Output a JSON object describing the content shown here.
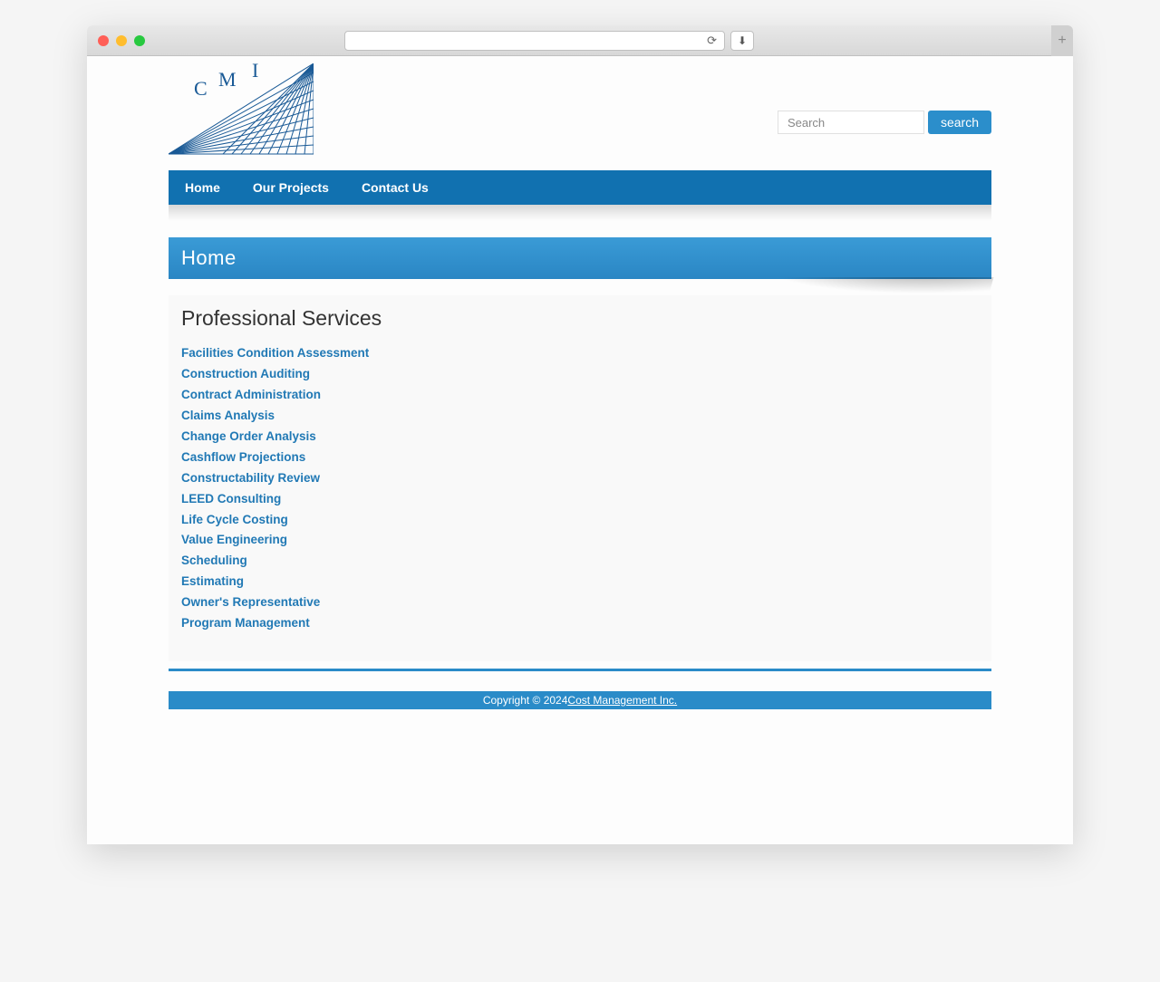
{
  "browser": {
    "url": ""
  },
  "logo": {
    "text_c": "C",
    "text_m": "M",
    "text_i": "I"
  },
  "search": {
    "placeholder": "Search",
    "button_label": "search"
  },
  "nav": {
    "items": [
      {
        "label": "Home"
      },
      {
        "label": "Our Projects"
      },
      {
        "label": "Contact Us"
      }
    ]
  },
  "page": {
    "title": "Home",
    "section_heading": "Professional Services"
  },
  "services": [
    "Facilities Condition Assessment",
    "Construction Auditing",
    "Contract Administration",
    "Claims Analysis",
    "Change Order Analysis",
    "Cashflow Projections",
    "Constructability Review",
    "LEED Consulting",
    "Life Cycle Costing",
    "Value Engineering",
    "Scheduling",
    "Estimating",
    "Owner's Representative",
    "Program Management"
  ],
  "footer": {
    "copyright_prefix": "Copyright © 2024 ",
    "company": "Cost Management Inc."
  }
}
